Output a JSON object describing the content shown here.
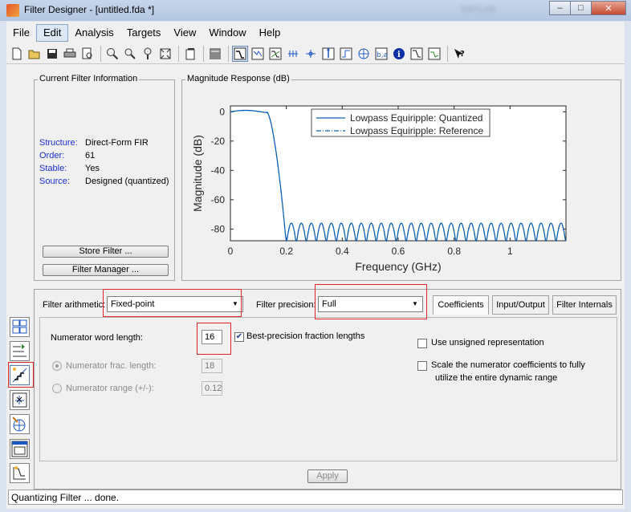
{
  "window": {
    "title": "Filter Designer - [untitled.fda *]",
    "blurred_text": "MATLAB",
    "buttons": {
      "minimize": "–",
      "maximize": "□",
      "close": "✕"
    }
  },
  "menu": {
    "items": [
      "File",
      "Edit",
      "Analysis",
      "Targets",
      "View",
      "Window",
      "Help"
    ],
    "active": "Edit"
  },
  "toolbar": {
    "icons": [
      "new-icon",
      "open-icon",
      "save-icon",
      "print-icon",
      "print-preview-icon",
      "zoom-in-icon",
      "zoom-x-icon",
      "zoom-y-icon",
      "full-view-icon",
      "new-window-icon",
      "legend-icon",
      "magnitude-response-icon",
      "phase-response-icon",
      "mag-phase-icon",
      "group-delay-icon",
      "phase-delay-icon",
      "impulse-response-icon",
      "step-response-icon",
      "pole-zero-icon",
      "coefficients-icon",
      "filter-info-icon",
      "magnitude-estimate-icon",
      "round-off-noise-icon",
      "whats-this-icon"
    ],
    "active_icon": "magnitude-response-icon"
  },
  "current_filter": {
    "title": "Current Filter Information",
    "rows": [
      {
        "key": "Structure:",
        "value": "Direct-Form FIR"
      },
      {
        "key": "Order:",
        "value": "61"
      },
      {
        "key": "Stable:",
        "value": "Yes"
      },
      {
        "key": "Source:",
        "value": "Designed (quantized)"
      }
    ],
    "store_button": "Store Filter ...",
    "manager_button": "Filter Manager ..."
  },
  "magnitude_panel": {
    "title": "Magnitude Response (dB)"
  },
  "chart_data": {
    "type": "line",
    "xlabel": "Frequency (GHz)",
    "ylabel": "Magnitude (dB)",
    "xlim": [
      0,
      1.2
    ],
    "ylim": [
      -88,
      4
    ],
    "xticks": [
      0,
      0.2,
      0.4,
      0.6,
      0.8,
      1
    ],
    "xtick_labels": [
      "0",
      "0.2",
      "0.4",
      "0.6",
      "0.8",
      "1"
    ],
    "yticks": [
      0,
      -20,
      -40,
      -60,
      -80
    ],
    "ytick_labels": [
      "0",
      "-20",
      "-40",
      "-60",
      "-80"
    ],
    "legend_position": "top-right",
    "series": [
      {
        "name": "Lowpass Equiripple: Quantized",
        "style": "solid",
        "color": "#0a5fb4",
        "passband_edge": 0.13,
        "stopband_edge": 0.2,
        "passband_ripple_db": 1,
        "stopband_floor_db": -76,
        "lobes": 28
      },
      {
        "name": "Lowpass Equiripple: Reference",
        "style": "dashdot",
        "color": "#0a5fb4",
        "passband_edge": 0.13,
        "stopband_edge": 0.2,
        "passband_ripple_db": 1,
        "stopband_floor_db": -76,
        "lobes": 28
      }
    ]
  },
  "quant": {
    "arith_label": "Filter arithmetic:",
    "arith_value": "Fixed-point",
    "precision_label": "Filter precision:",
    "precision_value": "Full",
    "tabs": [
      "Coefficients",
      "Input/Output",
      "Filter Internals"
    ],
    "active_tab": "Coefficients",
    "num_word_label": "Numerator word length:",
    "num_word_value": "16",
    "best_precision_label": "Best-precision fraction lengths",
    "best_precision_checked": "✔",
    "num_frac_label": "Numerator frac. length:",
    "num_frac_value": "18",
    "num_range_label": "Numerator range (+/-):",
    "num_range_value": "0.12",
    "unsigned_label": "Use unsigned representation",
    "scale_label_1": "Scale the numerator coefficients to fully",
    "scale_label_2": "utilize the entire dynamic range",
    "apply_button": "Apply",
    "dropdown_arrow": "▼"
  },
  "sidebar": {
    "icons": [
      "transform-filter-icon",
      "multirate-icon",
      "set-quantization-icon",
      "pole-zero-editor-icon",
      "design-filter-icon",
      "import-filter-icon",
      "realize-model-icon"
    ],
    "active_icon": "set-quantization-icon"
  },
  "status": {
    "text": "Quantizing Filter ... done."
  },
  "accent": {
    "highlight_red": "#e0222a",
    "line_blue": "#0a5fb4"
  }
}
